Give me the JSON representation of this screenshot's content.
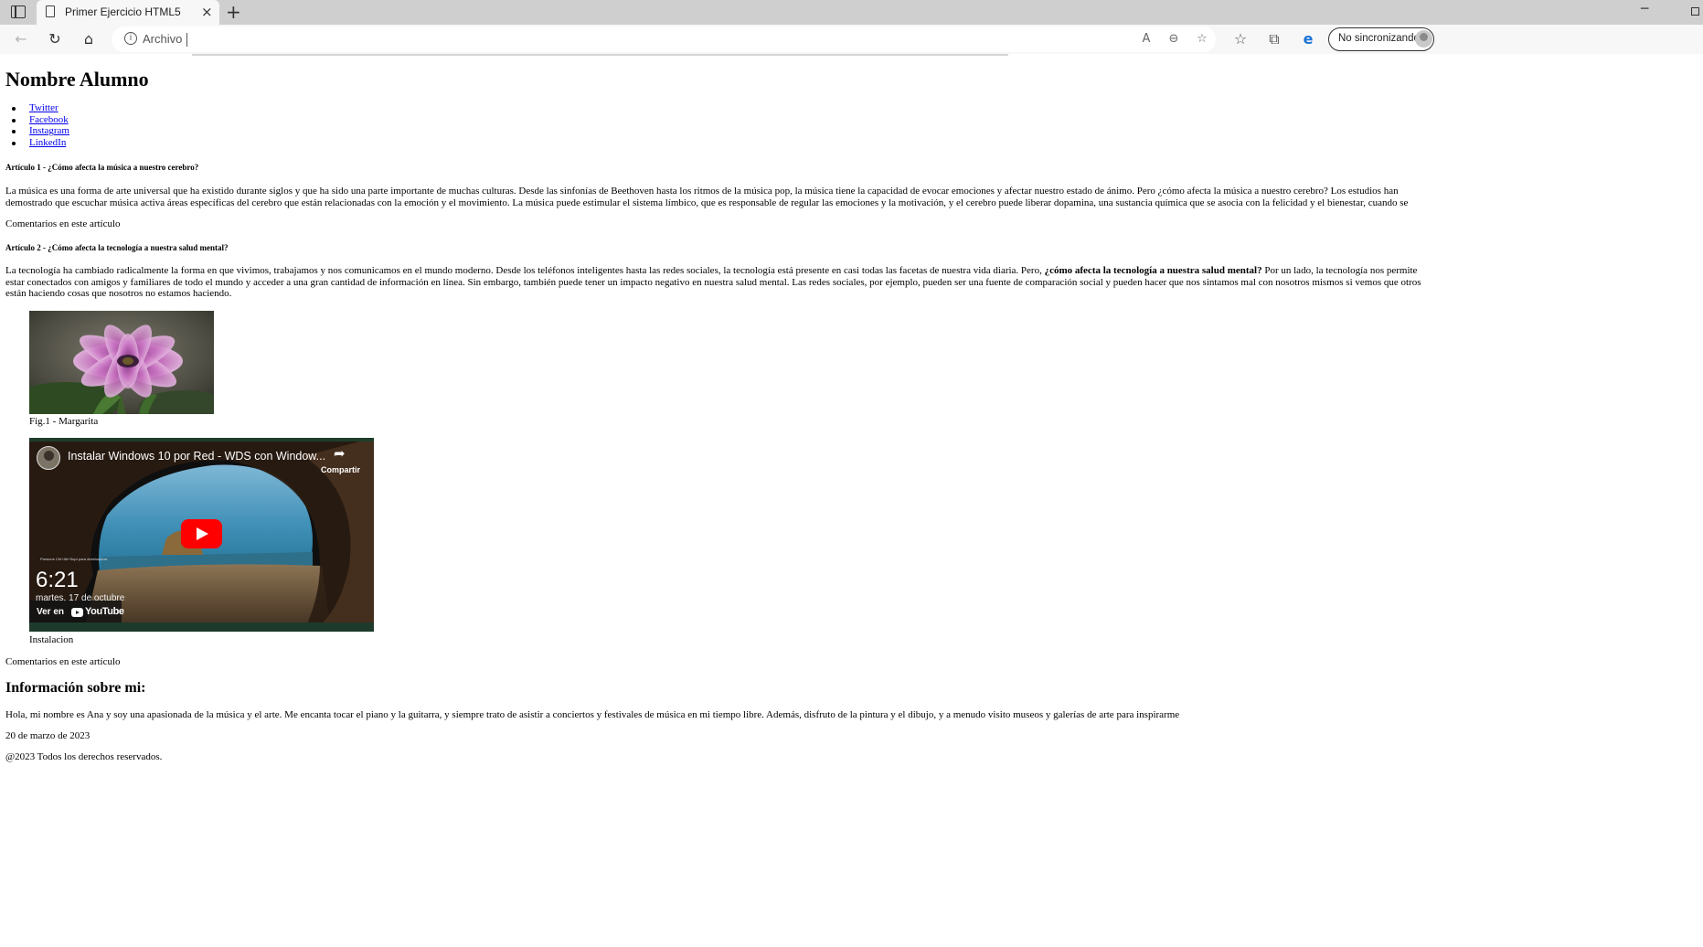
{
  "browser": {
    "tab_title": "Primer Ejercicio HTML5",
    "tab_close": "×",
    "new_tab": "+",
    "minimize": "─",
    "address_label": "Archivo",
    "profile_label": "No sincronizando",
    "icons": {
      "back": "←",
      "refresh": "↻",
      "home": "⌂",
      "info": "i",
      "read_aloud": "A",
      "zoom_out": "⊖",
      "add_favorite": "☆",
      "favorites": "☆",
      "collections": "⧉",
      "extension": "e"
    }
  },
  "page": {
    "heading": "Nombre Alumno",
    "nav_links": [
      "Twitter",
      "Facebook",
      "Instagram",
      "LinkedIn"
    ],
    "article1": {
      "title": "Artículo 1 - ¿Cómo afecta la música a nuestro cerebro?",
      "paragraph": "La música es una forma de arte universal que ha existido durante siglos y que ha sido una parte importante de muchas culturas. Desde las sinfonías de Beethoven hasta los ritmos de la música pop, la música tiene la capacidad de evocar emociones y afectar nuestro estado de ánimo. Pero ¿cómo afecta la música a nuestro cerebro? Los estudios han demostrado que escuchar música activa áreas específicas del cerebro que están relacionadas con la emoción y el movimiento. La música puede estimular el sistema límbico, que es responsable de regular las emociones y la motivación, y el cerebro puede liberar dopamina, una sustancia química que se asocia con la felicidad y el bienestar, cuando se escucha música que nos gusta.",
      "comments": "Comentarios en este artículo"
    },
    "article2": {
      "title": "Artículo 2 - ¿Cómo afecta la tecnología a nuestra salud mental?",
      "paragraph_before": "La tecnología ha cambiado radicalmente la forma en que vivimos, trabajamos y nos comunicamos en el mundo moderno. Desde los teléfonos inteligentes hasta las redes sociales, la tecnología está presente en casi todas las facetas de nuestra vida diaria. Pero, ",
      "paragraph_bold": "¿cómo afecta la tecnología a nuestra salud mental?",
      "paragraph_after": " Por un lado, la tecnología nos permite estar conectados con amigos y familiares de todo el mundo y acceder a una gran cantidad de información en línea. Sin embargo, también puede tener un impacto negativo en nuestra salud mental. Las redes sociales, por ejemplo, pueden ser una fuente de comparación social y pueden hacer que nos sintamos mal con nosotros mismos si vemos que otros están haciendo cosas que nosotros no estamos haciendo.",
      "figure_caption": "Fig.1 - Margarita",
      "video": {
        "title": "Instalar Windows 10 por Red - WDS con Window...",
        "share": "Compartir",
        "screen_time": "6:21",
        "screen_date": "martes, 17 de octubre",
        "lock_hint": "Presione Ctrl+Alt+Supr para desbloquear.",
        "watch_on": "Ver en",
        "youtube": "YouTube"
      },
      "video_caption": "Instalacion",
      "comments": "Comentarios en este artículo"
    },
    "about": {
      "heading": "Información sobre mi:",
      "text": "Hola, mi nombre es Ana y soy una apasionada de la música y el arte. Me encanta tocar el piano y la guitarra, y siempre trato de asistir a conciertos y festivales de música en mi tiempo libre. Además, disfruto de la pintura y el dibujo, y a menudo visito museos y galerías de arte para inspirarme",
      "date": "20 de marzo de 2023",
      "footer": "@2023 Todos los derechos reservados."
    }
  }
}
